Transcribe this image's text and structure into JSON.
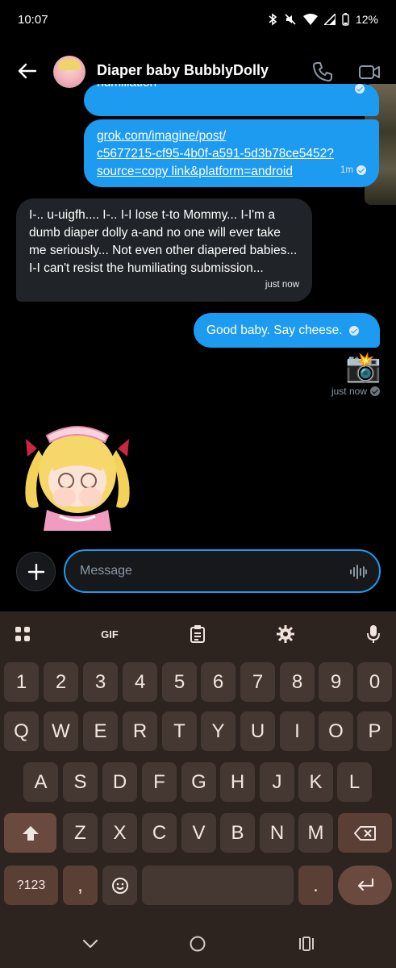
{
  "status": {
    "time": "10:07",
    "battery": "12%"
  },
  "header": {
    "title": "Diaper baby BubblyDolly"
  },
  "messages": {
    "partial_text": "humiliation",
    "link_text": "grok.com/imagine/post/\nc5677215-cf95-4b0f-a591-5d3b78ce5452?\nsource=copy link&platform=android",
    "link_time": "1m",
    "incoming_text": "I-.. u-uigfh.... I-.. I-I lose t-to Mommy... I-I'm a dumb diaper dolly a-and no one will ever take me seriously... Not even other diapered babies... I-I can't resist the humiliating submission...",
    "incoming_time": "just now",
    "outgoing_text": "Good baby. Say cheese.",
    "emoji": "📸",
    "emoji_time": "just now"
  },
  "composer": {
    "placeholder": "Message"
  },
  "keyboard": {
    "gif_label": "GIF",
    "row_numbers": [
      "1",
      "2",
      "3",
      "4",
      "5",
      "6",
      "7",
      "8",
      "9",
      "0"
    ],
    "row1": [
      "Q",
      "W",
      "E",
      "R",
      "T",
      "Y",
      "U",
      "I",
      "O",
      "P"
    ],
    "row2": [
      "A",
      "S",
      "D",
      "F",
      "G",
      "H",
      "J",
      "K",
      "L"
    ],
    "row3": [
      "Z",
      "X",
      "C",
      "V",
      "B",
      "N",
      "M"
    ],
    "symbols_label": "?123",
    "comma": ",",
    "period": "."
  },
  "colors": {
    "accent": "#1d9bf0",
    "incoming_bubble": "#202327",
    "keyboard_bg": "#2d2420",
    "key_bg": "#453833"
  }
}
